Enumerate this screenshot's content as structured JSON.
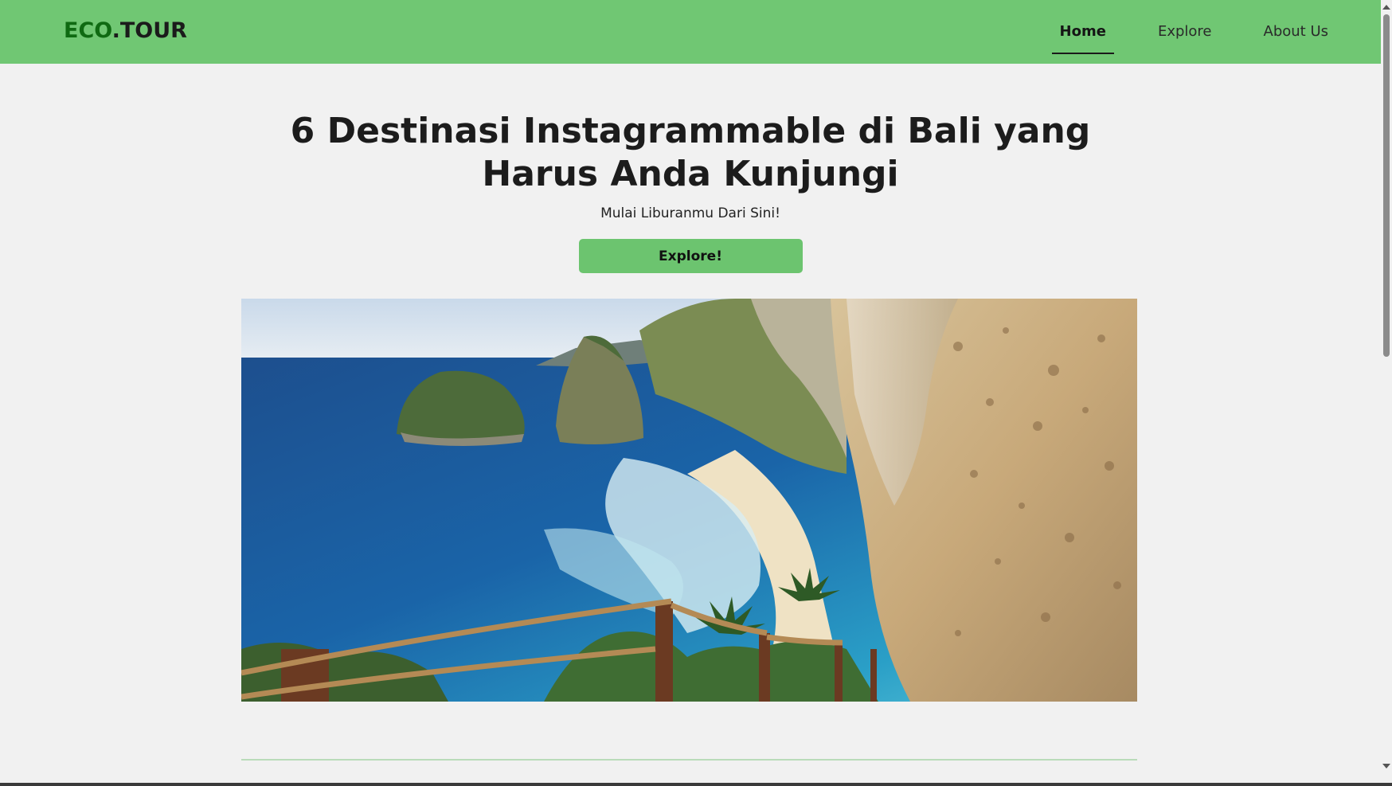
{
  "header": {
    "brand_prefix": "ECO",
    "brand_suffix": ".TOUR",
    "nav": [
      {
        "label": "Home",
        "active": true
      },
      {
        "label": "Explore",
        "active": false
      },
      {
        "label": "About Us",
        "active": false
      }
    ]
  },
  "hero": {
    "title": "6 Destinasi Instagrammable di Bali yang Harus Anda Kunjungi",
    "subtitle": "Mulai Liburanmu Dari Sini!",
    "cta_label": "Explore!"
  },
  "colors": {
    "navbar": "#70c773",
    "brand_accent": "#0f6a12",
    "cta": "#6cc46f",
    "background": "#f1f1f1"
  }
}
